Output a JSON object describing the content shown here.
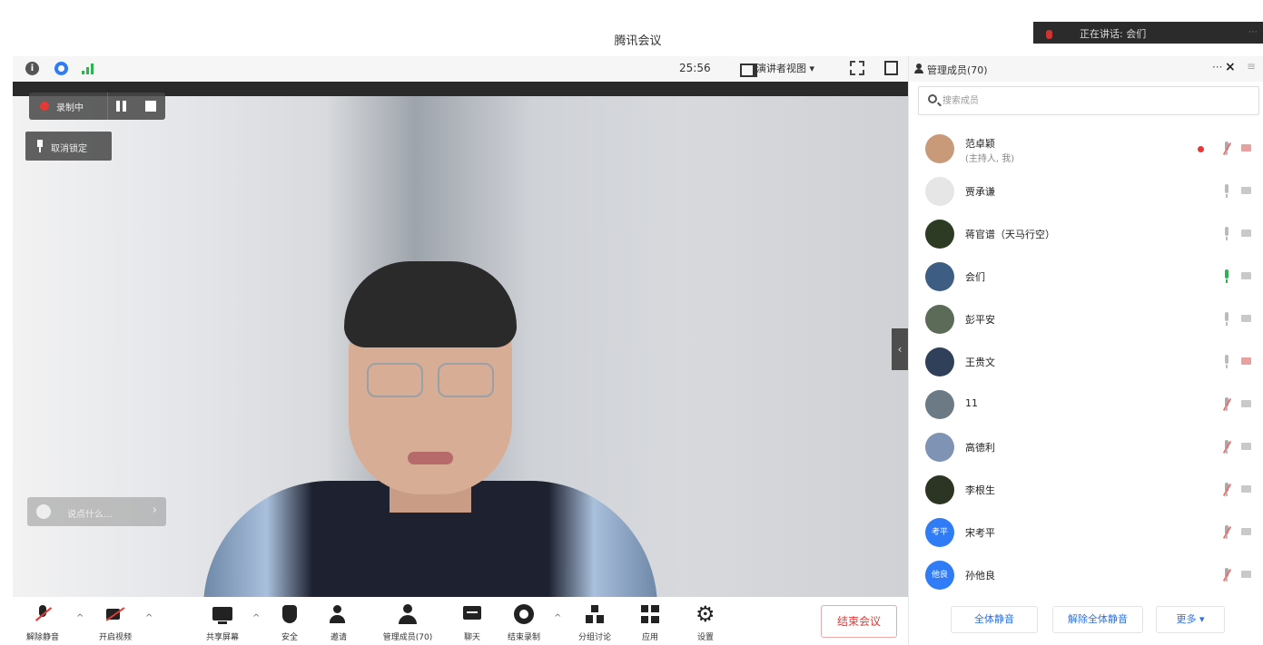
{
  "window": {
    "title": "腾讯会议"
  },
  "speaker_banner": {
    "label": "正在讲话: 会们"
  },
  "info_bar": {
    "info_icon": "info-icon",
    "security_icon": "shield-icon",
    "signal_icon": "signal-icon",
    "timer": "25:56",
    "view_mode": "演讲者视图 ▾"
  },
  "video": {
    "recording": {
      "label": "录制中"
    },
    "lock_label": "取消锁定",
    "chat_placeholder": "说点什么...",
    "collapse": "‹"
  },
  "toolbar": {
    "items": [
      {
        "label": "解除静音",
        "icon": "mic-off-icon"
      },
      {
        "label": "开启视频",
        "icon": "camera-off-icon"
      },
      {
        "label": "共享屏幕",
        "icon": "share-screen-icon"
      },
      {
        "label": "安全",
        "icon": "shield-icon"
      },
      {
        "label": "邀请",
        "icon": "invite-icon"
      },
      {
        "label": "管理成员(70)",
        "icon": "members-icon"
      },
      {
        "label": "聊天",
        "icon": "chat-icon"
      },
      {
        "label": "结束录制",
        "icon": "record-icon"
      },
      {
        "label": "分组讨论",
        "icon": "breakout-icon"
      },
      {
        "label": "应用",
        "icon": "apps-icon"
      },
      {
        "label": "设置",
        "icon": "gear-icon"
      }
    ],
    "caret": "^",
    "end_meeting": "结束会议"
  },
  "panel": {
    "title": "管理成员(70)",
    "more": "···",
    "close": "×",
    "menu": "≡",
    "search_placeholder": "搜索成员",
    "members": [
      {
        "name": "范卓颖",
        "sub": "(主持人, 我)",
        "avatar_color": "#c89a7a",
        "recording": true,
        "mic": "muted",
        "cam": "red"
      },
      {
        "name": "贾承谦",
        "sub": "",
        "avatar_color": "#e6e6e6",
        "recording": false,
        "mic": "off",
        "cam": "grey"
      },
      {
        "name": "蒋官谱（天马行空）",
        "sub": "",
        "avatar_color": "#2d3b24",
        "recording": false,
        "mic": "off",
        "cam": "grey"
      },
      {
        "name": "会们",
        "sub": "",
        "avatar_color": "#3d5d83",
        "recording": false,
        "mic": "on",
        "cam": "grey"
      },
      {
        "name": "彭平安",
        "sub": "",
        "avatar_color": "#5b6b57",
        "recording": false,
        "mic": "off",
        "cam": "grey"
      },
      {
        "name": "王贵文",
        "sub": "",
        "avatar_color": "#2f4058",
        "recording": false,
        "mic": "off",
        "cam": "red"
      },
      {
        "name": "11",
        "sub": "",
        "avatar_color": "#6c7a86",
        "recording": false,
        "mic": "muted",
        "cam": "grey"
      },
      {
        "name": "高德利",
        "sub": "",
        "avatar_color": "#7f93b4",
        "recording": false,
        "mic": "muted",
        "cam": "grey"
      },
      {
        "name": "李根生",
        "sub": "",
        "avatar_color": "#2c3424",
        "recording": false,
        "mic": "muted",
        "cam": "grey"
      },
      {
        "name": "宋考平",
        "sub": "",
        "avatar_color": "#2f7cf6",
        "avatar_text": "考平",
        "recording": false,
        "mic": "muted",
        "cam": "grey"
      },
      {
        "name": "孙他良",
        "sub": "",
        "avatar_color": "#2f7cf6",
        "avatar_text": "他良",
        "recording": false,
        "mic": "muted",
        "cam": "grey"
      }
    ],
    "footer": {
      "mute_all": "全体静音",
      "unmute_all": "解除全体静音",
      "more": "更多 ▾"
    }
  }
}
